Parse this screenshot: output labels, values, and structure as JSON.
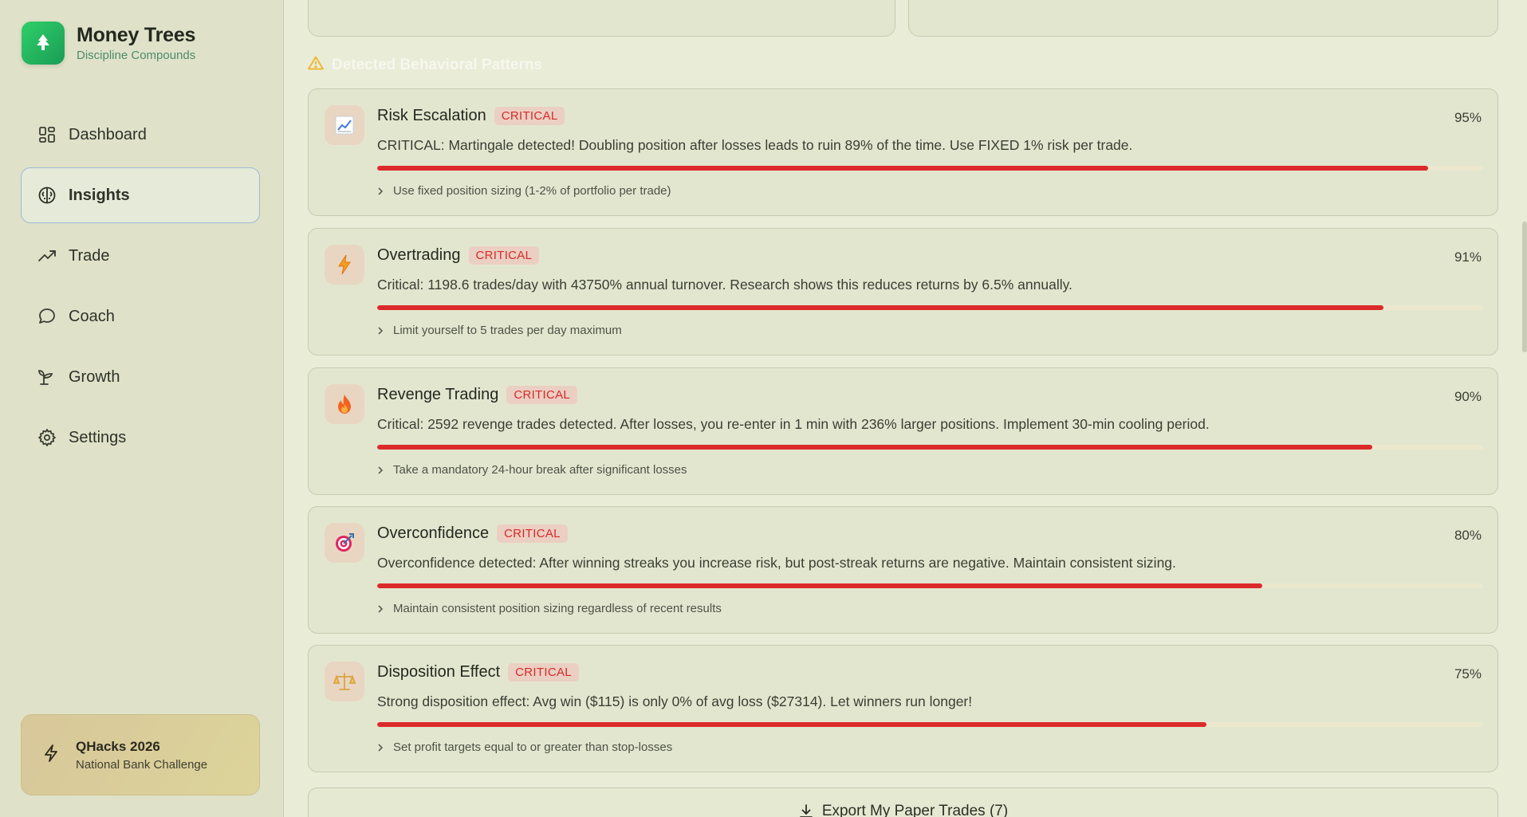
{
  "brand": {
    "title": "Money Trees",
    "subtitle": "Discipline Compounds"
  },
  "nav": [
    {
      "label": "Dashboard",
      "icon": "dashboard-grid-icon",
      "active": false
    },
    {
      "label": "Insights",
      "icon": "brain-icon",
      "active": true
    },
    {
      "label": "Trade",
      "icon": "trending-up-icon",
      "active": false
    },
    {
      "label": "Coach",
      "icon": "chat-bubble-icon",
      "active": false
    },
    {
      "label": "Growth",
      "icon": "sprout-icon",
      "active": false
    },
    {
      "label": "Settings",
      "icon": "gear-icon",
      "active": false
    }
  ],
  "promo": {
    "title": "QHacks 2026",
    "subtitle": "National Bank Challenge"
  },
  "section": {
    "title": "Detected Behavioral Patterns"
  },
  "patterns": [
    {
      "title": "Risk Escalation",
      "badge": "CRITICAL",
      "percent_label": "95%",
      "confidence": 0.95,
      "description": "CRITICAL: Martingale detected! Doubling position after losses leads to ruin 89% of the time. Use FIXED 1% risk per trade.",
      "tip": "Use fixed position sizing (1-2% of portfolio per trade)",
      "icon": "chart-increasing-icon"
    },
    {
      "title": "Overtrading",
      "badge": "CRITICAL",
      "percent_label": "91%",
      "confidence": 0.91,
      "description": "Critical: 1198.6 trades/day with 43750% annual turnover. Research shows this reduces returns by 6.5% annually.",
      "tip": "Limit yourself to 5 trades per day maximum",
      "icon": "lightning-icon"
    },
    {
      "title": "Revenge Trading",
      "badge": "CRITICAL",
      "percent_label": "90%",
      "confidence": 0.9,
      "description": "Critical: 2592 revenge trades detected. After losses, you re-enter in 1 min with 236% larger positions. Implement 30-min cooling period.",
      "tip": "Take a mandatory 24-hour break after significant losses",
      "icon": "fire-icon"
    },
    {
      "title": "Overconfidence",
      "badge": "CRITICAL",
      "percent_label": "80%",
      "confidence": 0.8,
      "description": "Overconfidence detected: After winning streaks you increase risk, but post-streak returns are negative. Maintain consistent sizing.",
      "tip": "Maintain consistent position sizing regardless of recent results",
      "icon": "target-icon"
    },
    {
      "title": "Disposition Effect",
      "badge": "CRITICAL",
      "percent_label": "75%",
      "confidence": 0.75,
      "description": "Strong disposition effect: Avg win ($115) is only 0% of avg loss ($27314). Let winners run longer!",
      "tip": "Set profit targets equal to or greater than stop-losses",
      "icon": "balance-scale-icon"
    }
  ],
  "export": {
    "label": "Export My Paper Trades (7)"
  },
  "colors": {
    "critical": "#dc2a2a",
    "brand_green": "#1fae5b",
    "warning": "#f0b429"
  }
}
